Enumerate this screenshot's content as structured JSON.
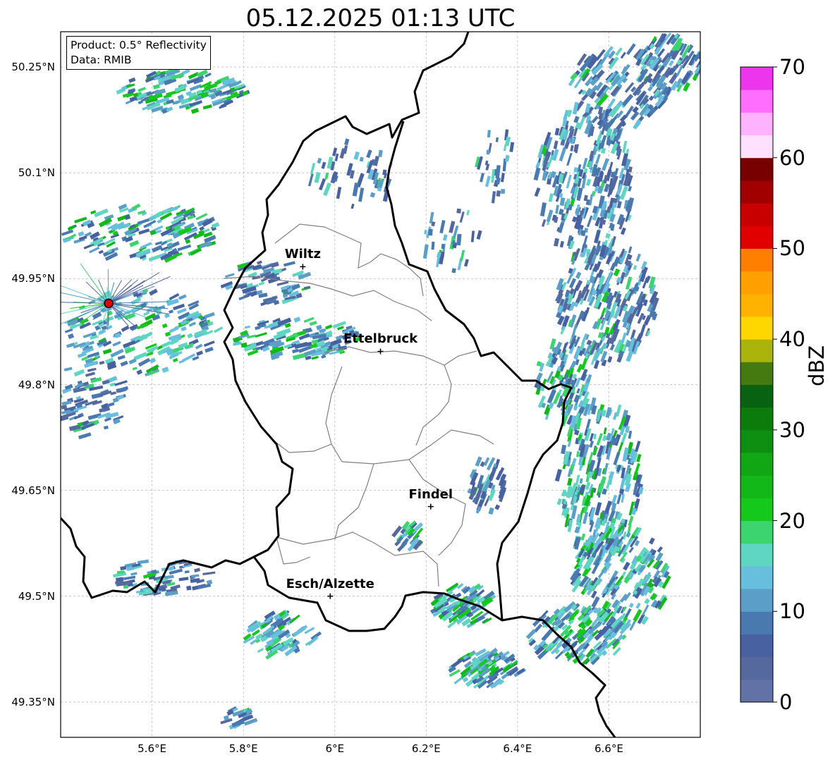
{
  "title": "05.12.2025 01:13 UTC",
  "info": {
    "product": "Product: 0.5° Reflectivity",
    "data": "Data: RMIB"
  },
  "map": {
    "lon_range": [
      5.4,
      6.8
    ],
    "lat_range": [
      49.3,
      50.3
    ],
    "lat_ticks": [
      {
        "value": 50.25,
        "label": "50.25°N"
      },
      {
        "value": 50.1,
        "label": "50.1°N"
      },
      {
        "value": 49.95,
        "label": "49.95°N"
      },
      {
        "value": 49.8,
        "label": "49.8°N"
      },
      {
        "value": 49.65,
        "label": "49.65°N"
      },
      {
        "value": 49.5,
        "label": "49.5°N"
      },
      {
        "value": 49.35,
        "label": "49.35°N"
      }
    ],
    "lon_ticks": [
      {
        "value": 5.6,
        "label": "5.6°E"
      },
      {
        "value": 5.8,
        "label": "5.8°E"
      },
      {
        "value": 6.0,
        "label": "6°E"
      },
      {
        "value": 6.2,
        "label": "6.2°E"
      },
      {
        "value": 6.4,
        "label": "6.4°E"
      },
      {
        "value": 6.6,
        "label": "6.6°E"
      }
    ],
    "cities": [
      {
        "name": "Wiltz",
        "lon": 5.93,
        "lat": 49.967
      },
      {
        "name": "Ettelbruck",
        "lon": 6.1,
        "lat": 49.847
      },
      {
        "name": "Findel",
        "lon": 6.21,
        "lat": 49.627
      },
      {
        "name": "Esch/Alzette",
        "lon": 5.99,
        "lat": 49.5
      }
    ],
    "radar_site": {
      "lon": 5.505,
      "lat": 49.915
    },
    "grid": true,
    "colors": {
      "border": "#000000",
      "canton": "#808080",
      "grid": "#bbbbbb",
      "radar_site": "#e00000"
    }
  },
  "colorbar": {
    "label": "dBZ",
    "min": 0,
    "max": 70,
    "ticks": [
      0,
      10,
      20,
      30,
      40,
      50,
      60,
      70
    ],
    "colors": [
      "#6272a6",
      "#56699f",
      "#4861a1",
      "#4a79b0",
      "#5b9ec7",
      "#68bfdd",
      "#5fd6c2",
      "#3cd46e",
      "#14c81c",
      "#12b818",
      "#11a613",
      "#0f8f11",
      "#0b7b0c",
      "#076211",
      "#457a10",
      "#aab40a",
      "#ffd700",
      "#ffb300",
      "#ffa000",
      "#ff8000",
      "#e10000",
      "#c80000",
      "#a00000",
      "#780000",
      "#ffe0ff",
      "#ffb3ff",
      "#ff6eff",
      "#ee35ee"
    ]
  }
}
